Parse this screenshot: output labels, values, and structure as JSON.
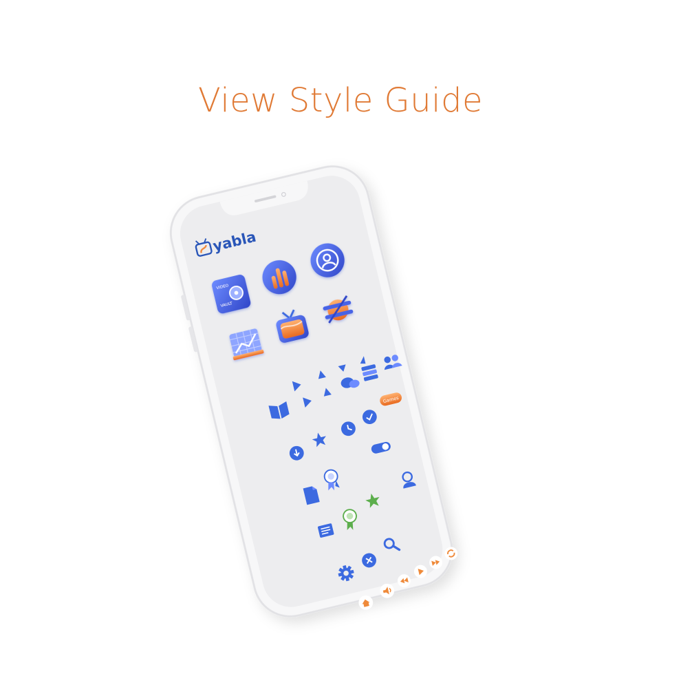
{
  "page": {
    "title": "View Style Guide"
  },
  "brand": {
    "logo_text": "yabla",
    "logo_color": "#2a56b8",
    "accent": "#f08a3c"
  },
  "icons": {
    "vault": {
      "name": "video-vault-icon",
      "lines": [
        "VIDEO",
        "VAULT"
      ]
    },
    "games_badge": "Games"
  },
  "colors": {
    "blue": "#3c6ae0",
    "orange": "#ef8a3a",
    "green": "#5cae4c",
    "screen": "#ededef"
  }
}
